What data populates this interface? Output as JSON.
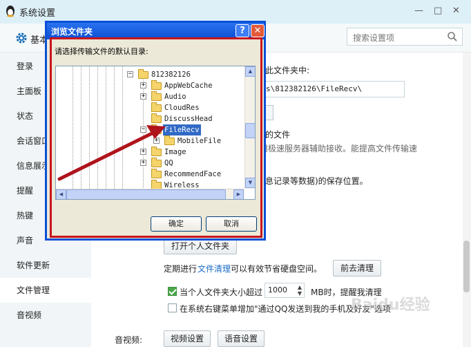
{
  "window": {
    "title": "系统设置",
    "minimize_glyph": "—",
    "maximize_glyph": "□",
    "close_glyph": "✕"
  },
  "header": {
    "section_label": "基本",
    "search_placeholder": "搜索设置项"
  },
  "sidebar": {
    "items": [
      {
        "label": "登录"
      },
      {
        "label": "主面板"
      },
      {
        "label": "状态"
      },
      {
        "label": "会话窗口"
      },
      {
        "label": "信息展示"
      },
      {
        "label": "提醒"
      },
      {
        "label": "热键"
      },
      {
        "label": "声音"
      },
      {
        "label": "软件更新"
      },
      {
        "label": "文件管理"
      },
      {
        "label": "音视频"
      }
    ],
    "active_index": 9
  },
  "main": {
    "folder_heading": "此文件夹中:",
    "folder_path": "s\\812382126\\FileRecv\\",
    "fast_transfer_title": "的文件",
    "fast_transfer_desc": "用极速服务器辅助接收。能提高文件传输速",
    "storage_desc": "息记录等数据)的保存位置。",
    "open_personal_folder": "打开个人文件夹",
    "cleanup_prefix": "定期进行",
    "cleanup_link": "文件清理",
    "cleanup_suffix": "可以有效节省硬盘空间。",
    "cleanup_button": "前去清理",
    "size_alert_label": "当个人文件夹大小超过",
    "size_alert_value": "1000",
    "size_alert_suffix": "MB时，提醒我清理",
    "size_alert_checked": true,
    "context_menu_label": "在系统右键菜单增加\"通过QQ发送到我的手机及好友\"选项",
    "context_menu_checked": false,
    "av_label": "音视频:",
    "video_settings": "视频设置",
    "audio_settings": "语音设置"
  },
  "dialog": {
    "title": "浏览文件夹",
    "help_glyph": "?",
    "close_glyph": "✕",
    "prompt": "请选择传输文件的默认目录:",
    "tree": [
      {
        "label": "812382126",
        "expander": "−",
        "level": 0
      },
      {
        "label": "AppWebCache",
        "expander": "+",
        "level": 1
      },
      {
        "label": "Audio",
        "expander": "+",
        "level": 1
      },
      {
        "label": "CloudRes",
        "expander": "",
        "level": 1
      },
      {
        "label": "DiscussHead",
        "expander": "",
        "level": 1
      },
      {
        "label": "FileRecv",
        "expander": "−",
        "level": 1,
        "selected": true
      },
      {
        "label": "MobileFile",
        "expander": "+",
        "level": 2
      },
      {
        "label": "Image",
        "expander": "+",
        "level": 1
      },
      {
        "label": "QQ",
        "expander": "+",
        "level": 1
      },
      {
        "label": "RecommendFace",
        "expander": "",
        "level": 1
      },
      {
        "label": "Wireless",
        "expander": "",
        "level": 1
      }
    ],
    "ok_label": "确定",
    "cancel_label": "取消"
  },
  "watermark": "Baidu经验",
  "colors": {
    "highlight_frame": "#c8141c",
    "arrow": "#b0141c",
    "selection": "#316ac5",
    "dialog_title": "#0b4ed2"
  }
}
